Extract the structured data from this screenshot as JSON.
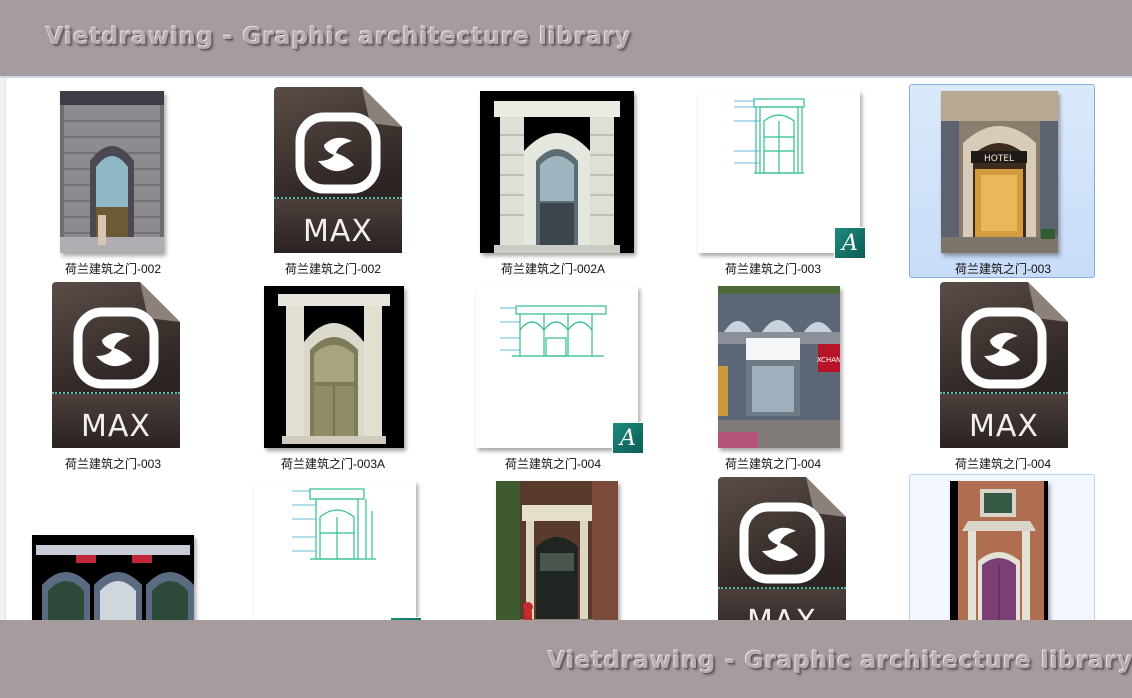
{
  "banner": {
    "top_text": "Vietdrawing - Graphic architecture library",
    "bottom_text": "Vietdrawing - Graphic architecture library"
  },
  "files": [
    {
      "name": "荷兰建筑之门-002",
      "kind": "photo"
    },
    {
      "name": "荷兰建筑之门-002",
      "kind": "max",
      "label": "MAX"
    },
    {
      "name": "荷兰建筑之门-002A",
      "kind": "render"
    },
    {
      "name": "荷兰建筑之门-003",
      "kind": "cad"
    },
    {
      "name": "荷兰建筑之门-003",
      "kind": "photo",
      "selected": true,
      "sign": "HOTEL"
    },
    {
      "name": "荷兰建筑之门-003",
      "kind": "max",
      "label": "MAX"
    },
    {
      "name": "荷兰建筑之门-003A",
      "kind": "render"
    },
    {
      "name": "荷兰建筑之门-004",
      "kind": "cad"
    },
    {
      "name": "荷兰建筑之门-004",
      "kind": "photo",
      "sign": "XCHAN"
    },
    {
      "name": "荷兰建筑之门-004",
      "kind": "max",
      "label": "MAX"
    },
    {
      "name": "",
      "kind": "render"
    },
    {
      "name": "",
      "kind": "cad"
    },
    {
      "name": "",
      "kind": "photo"
    },
    {
      "name": "",
      "kind": "max",
      "label": "MAX"
    },
    {
      "name": "",
      "kind": "render",
      "hover": true
    }
  ],
  "colors": {
    "banner": "#a79c9d",
    "cad_line": "#2fbf8f",
    "selection": "#c8dcf8",
    "max_dark": "#2e2623"
  }
}
